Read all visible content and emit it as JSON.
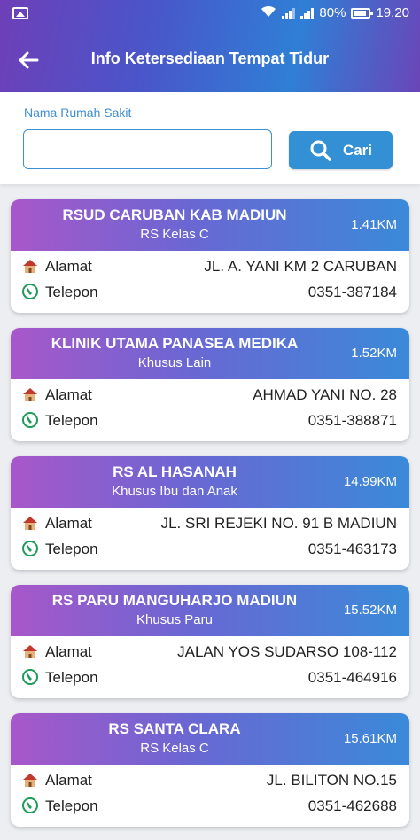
{
  "status_bar": {
    "battery": "80%",
    "time": "19.20",
    "sim1": "1",
    "sim2": "2"
  },
  "app_bar": {
    "title": "Info Ketersediaan Tempat Tidur"
  },
  "search": {
    "label": "Nama Rumah Sakit",
    "value": "",
    "placeholder": "",
    "button_label": "Cari"
  },
  "row_labels": {
    "address": "Alamat",
    "phone": "Telepon"
  },
  "hospitals": [
    {
      "name": "RSUD CARUBAN KAB MADIUN",
      "type": "RS Kelas C",
      "distance": "1.41KM",
      "address": "JL. A. YANI KM 2 CARUBAN",
      "phone": "0351-387184"
    },
    {
      "name": "KLINIK UTAMA PANASEA MEDIKA",
      "type": "Khusus Lain",
      "distance": "1.52KM",
      "address": "AHMAD YANI NO. 28",
      "phone": "0351-388871"
    },
    {
      "name": "RS AL HASANAH",
      "type": "Khusus Ibu dan Anak",
      "distance": "14.99KM",
      "address": "JL. SRI REJEKI NO. 91 B MADIUN",
      "phone": "0351-463173"
    },
    {
      "name": "RS PARU MANGUHARJO MADIUN",
      "type": "Khusus Paru",
      "distance": "15.52KM",
      "address": "JALAN YOS SUDARSO 108-112",
      "phone": "0351-464916"
    },
    {
      "name": "RS SANTA CLARA",
      "type": "RS Kelas C",
      "distance": "15.61KM",
      "address": "JL. BILITON NO.15",
      "phone": "0351-462688"
    }
  ],
  "colors": {
    "accent": "#3390d4",
    "card_gradient_start": "#a857c9",
    "card_gradient_end": "#3a8ad9"
  }
}
